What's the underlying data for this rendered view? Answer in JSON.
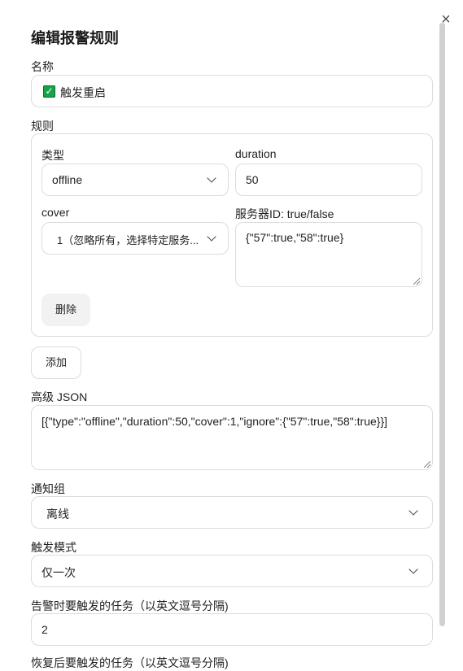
{
  "dialog": {
    "title": "编辑报警规则",
    "close_symbol": "×"
  },
  "name_field": {
    "label": "名称",
    "value": "触发重启",
    "check_symbol": "✓"
  },
  "rules": {
    "label": "规则",
    "type": {
      "label": "类型",
      "value": "offline"
    },
    "duration": {
      "label": "duration",
      "value": "50"
    },
    "cover": {
      "label": "cover",
      "value": "1（忽略所有，选择特定服务..."
    },
    "server_ids": {
      "label": "服务器ID: true/false",
      "value": "{\"57\":true,\"58\":true}"
    },
    "delete_label": "删除"
  },
  "add_label": "添加",
  "advanced_json": {
    "label": "高级 JSON",
    "value": "[{\"type\":\"offline\",\"duration\":50,\"cover\":1,\"ignore\":{\"57\":true,\"58\":true}}]"
  },
  "notification_group": {
    "label": "通知组",
    "value": "离线"
  },
  "trigger_mode": {
    "label": "触发模式",
    "value": "仅一次"
  },
  "alert_tasks": {
    "label": "告警时要触发的任务（以英文逗号分隔)",
    "value": "2"
  },
  "recovery_tasks": {
    "label": "恢复后要触发的任务（以英文逗号分隔)"
  },
  "icons": {
    "close": "close-icon",
    "check": "checkbox-check-icon",
    "dropdown": "chevron-down-icon"
  },
  "colors": {
    "border": "#dcdcdc",
    "check_green": "#16a34a",
    "button_gray": "#f2f2f2"
  }
}
